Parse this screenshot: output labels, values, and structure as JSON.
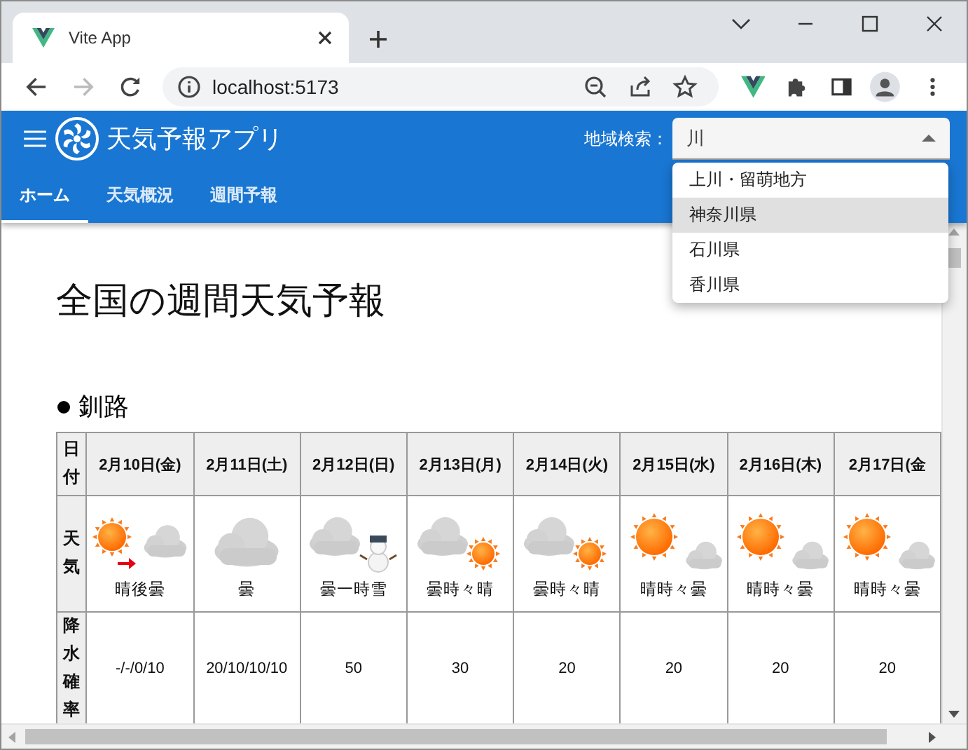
{
  "browser": {
    "tab_title": "Vite App",
    "url": "localhost:5173"
  },
  "app": {
    "title": "天気予報アプリ",
    "search_label": "地域検索：",
    "search_value": "川"
  },
  "nav_tabs": [
    {
      "label": "ホーム",
      "selected": true
    },
    {
      "label": "天気概況",
      "selected": false
    },
    {
      "label": "週間予報",
      "selected": false
    }
  ],
  "dropdown": [
    {
      "label": "上川・留萌地方",
      "highlighted": false
    },
    {
      "label": "神奈川県",
      "highlighted": true
    },
    {
      "label": "石川県",
      "highlighted": false
    },
    {
      "label": "香川県",
      "highlighted": false
    }
  ],
  "heading": "全国の週間天気予報",
  "region": "釧路",
  "table": {
    "row_labels": [
      "日付",
      "天気",
      "降水確率"
    ],
    "days": [
      {
        "date": "2月10日(金)",
        "kind": "sun_then_cloud",
        "weather": "晴後曇",
        "precip": "-/-/0/10"
      },
      {
        "date": "2月11日(土)",
        "kind": "cloud",
        "weather": "曇",
        "precip": "20/10/10/10"
      },
      {
        "date": "2月12日(日)",
        "kind": "cloud_snow",
        "weather": "曇一時雪",
        "precip": "50"
      },
      {
        "date": "2月13日(月)",
        "kind": "cloud_sun",
        "weather": "曇時々晴",
        "precip": "30"
      },
      {
        "date": "2月14日(火)",
        "kind": "cloud_sun",
        "weather": "曇時々晴",
        "precip": "20"
      },
      {
        "date": "2月15日(水)",
        "kind": "sun_cloud",
        "weather": "晴時々曇",
        "precip": "20"
      },
      {
        "date": "2月16日(木)",
        "kind": "sun_cloud",
        "weather": "晴時々曇",
        "precip": "20"
      },
      {
        "date": "2月17日(金",
        "kind": "sun_cloud",
        "weather": "晴時々曇",
        "precip": "20"
      }
    ]
  }
}
